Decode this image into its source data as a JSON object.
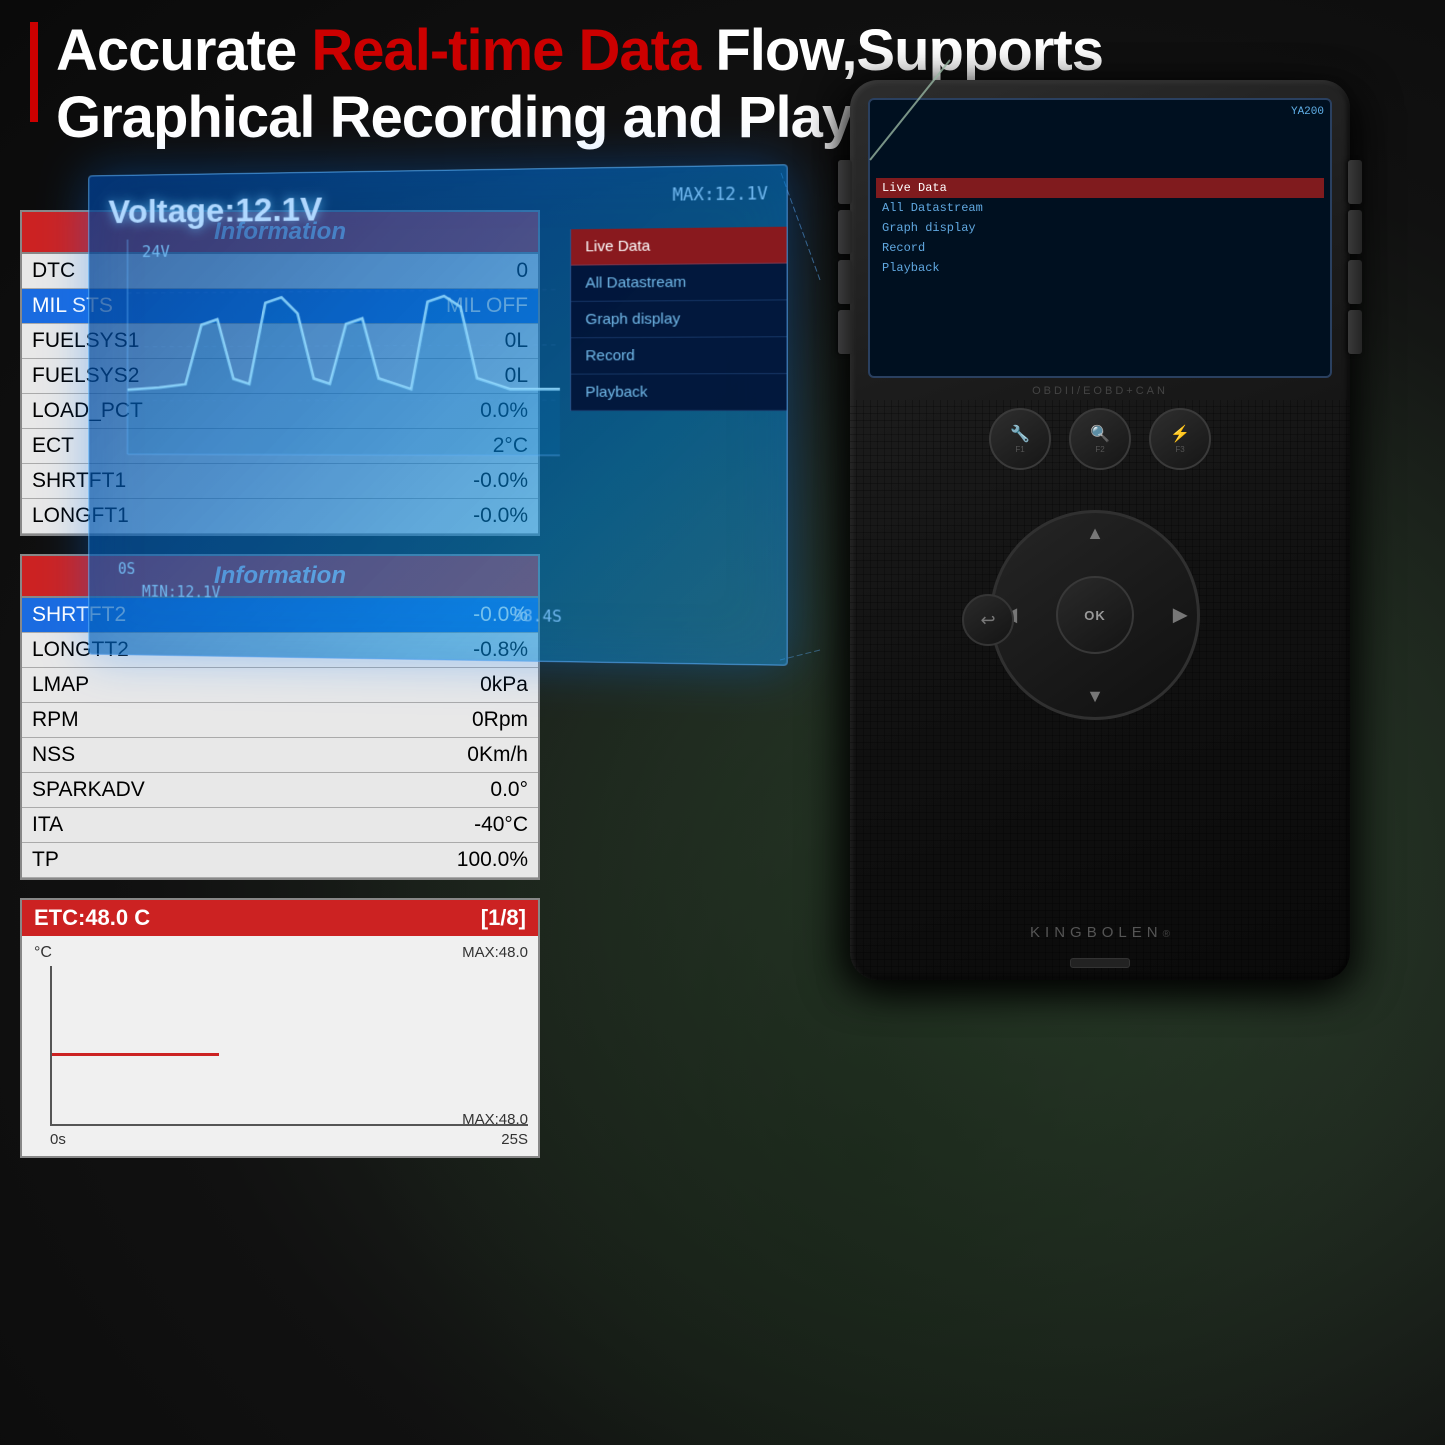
{
  "header": {
    "title_part1": "Accurate ",
    "title_red": "Real-time Data",
    "title_part2": " Flow,Supports",
    "title_line2": "Graphical Recording and Playback"
  },
  "table1": {
    "header": "Information",
    "rows": [
      {
        "label": "DTC",
        "value": "0",
        "highlighted": false
      },
      {
        "label": "MIL STS",
        "value": "MIL  OFF",
        "highlighted": true
      },
      {
        "label": "FUELSYS1",
        "value": "0L",
        "highlighted": false
      },
      {
        "label": "FUELSYS2",
        "value": "0L",
        "highlighted": false
      },
      {
        "label": "LOAD_PCT",
        "value": "0.0%",
        "highlighted": false
      },
      {
        "label": "ECT",
        "value": "2°C",
        "highlighted": false
      },
      {
        "label": "SHRTFT1",
        "value": "-0.0%",
        "highlighted": false
      },
      {
        "label": "LONGFT1",
        "value": "-0.0%",
        "highlighted": false
      }
    ]
  },
  "table2": {
    "header": "Information",
    "rows": [
      {
        "label": "SHRTFT2",
        "value": "-0.0%",
        "highlighted": true
      },
      {
        "label": "LONGTT2",
        "value": "-0.8%",
        "highlighted": false
      },
      {
        "label": "LMAP",
        "value": "0kPa",
        "highlighted": false
      },
      {
        "label": "RPM",
        "value": "0Rpm",
        "highlighted": false
      },
      {
        "label": "NSS",
        "value": "0Km/h",
        "highlighted": false
      },
      {
        "label": "SPARKADV",
        "value": "0.0°",
        "highlighted": false
      },
      {
        "label": "ITA",
        "value": "-40°C",
        "highlighted": false
      },
      {
        "label": "TP",
        "value": "100.0%",
        "highlighted": false
      }
    ]
  },
  "etc_chart": {
    "header_left": "ETC:48.0 C",
    "header_right": "[1/8]",
    "y_label": "°C",
    "max_top": "MAX:48.0",
    "max_bottom": "MAX:48.0",
    "x_start": "0s",
    "x_end": "25S"
  },
  "holo": {
    "voltage": "Voltage:12.1V",
    "max": "MAX:12.1V",
    "y_24v": "24V",
    "y_0s": "0S",
    "min_val": "MIN:12.1V",
    "time_val": "98.4S",
    "menu_items": [
      {
        "label": "Live Data",
        "active": true
      },
      {
        "label": "All Datastream",
        "active": false
      },
      {
        "label": "Graph display",
        "active": false
      },
      {
        "label": "Record",
        "active": false
      },
      {
        "label": "Playback",
        "active": false
      }
    ]
  },
  "device": {
    "model": "YA200",
    "obdii_label": "OBDII/EOBD+CAN",
    "brand": "KINGBOLEN",
    "brand_reg": "®",
    "func_buttons": [
      {
        "icon": "🔧",
        "label": "F1"
      },
      {
        "icon": "🔍",
        "label": "F2"
      },
      {
        "icon": "⚡",
        "label": "F3"
      }
    ],
    "dpad_center": "OK",
    "back_label": "⟵"
  }
}
